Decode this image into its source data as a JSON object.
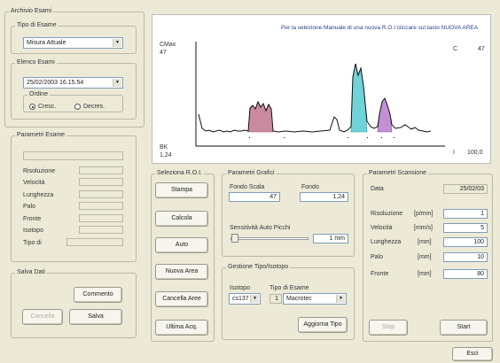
{
  "archive": {
    "title": "Archivio Esami",
    "tipo_esame": {
      "legend": "Tipo di Esame",
      "value": "Misura Attuale"
    },
    "elenco_esami": {
      "legend": "Elenco Esami",
      "value": "25/02/2003 16.15.54",
      "ordine_label": "Ordine",
      "cresc": "Cresc.",
      "decres": "Decres."
    }
  },
  "parametri_esame": {
    "legend": "Parametri Esame",
    "labels": [
      "Risoluzione",
      "Velocità",
      "Lunghezza",
      "Palo",
      "Fronte",
      "Isotopo",
      "Tipo di"
    ]
  },
  "salva_dati": {
    "legend": "Salva Dati",
    "commento": "Commento",
    "cancella": "Cancella",
    "salva": "Salva"
  },
  "chart": {
    "instruction": "Per la selezione Manuale di una nuova R.O.I cliccare sul tasto NUOVA AREA",
    "cmax_label": "CMax",
    "cmax_value": "47",
    "c_label": "C",
    "c_value": "47",
    "bk_label": "BK",
    "bk_value": "1,24",
    "i_label": "I",
    "i_value": "100,0",
    "colors": {
      "line": "#111111",
      "roi1": "#c98aa0",
      "roi2": "#6fd3d8",
      "roi3": "#c58fd6"
    }
  },
  "seleziona_roi": {
    "legend": "Seleziona R.O.I.",
    "buttons": [
      "Stampa",
      "Calcola",
      "Auto",
      "Nuova Area",
      "Cancella Aree",
      "Ultima Acq."
    ]
  },
  "parametri_grafici": {
    "legend": "Parametri Grafici",
    "fondo_scala_label": "Fondo Scala",
    "fondo_scala_value": "47",
    "fondo_label": "Fondo",
    "fondo_value": "1,24",
    "sensibilita_label": "Sensitività Auto Picchi",
    "sensibilita_value": "1 mm"
  },
  "gestione": {
    "legend": "Gestione Tipo/Isotopo",
    "isotopo_label": "Isotopo",
    "isotopo_value": "cs137",
    "tipo_label": "Tipo di Esame",
    "tipo_number": "1",
    "tipo_value": "Macrotec",
    "aggiorna": "Aggiorna Tipo"
  },
  "parametri_scansione": {
    "legend": "Parametri Scansione",
    "data_label": "Data",
    "data_value": "25/02/03",
    "rows": [
      {
        "label": "Risoluzione",
        "unit": "[p/mm]",
        "value": "1"
      },
      {
        "label": "Velocità",
        "unit": "[mm/s]",
        "value": "5"
      },
      {
        "label": "Lunghezza",
        "unit": "[mm]",
        "value": "100"
      },
      {
        "label": "Palo",
        "unit": "[mm]",
        "value": "10"
      },
      {
        "label": "Fronte",
        "unit": "[mm]",
        "value": "80"
      }
    ],
    "stop": "Stop",
    "start": "Start"
  },
  "footer": {
    "esci": "Esci"
  }
}
